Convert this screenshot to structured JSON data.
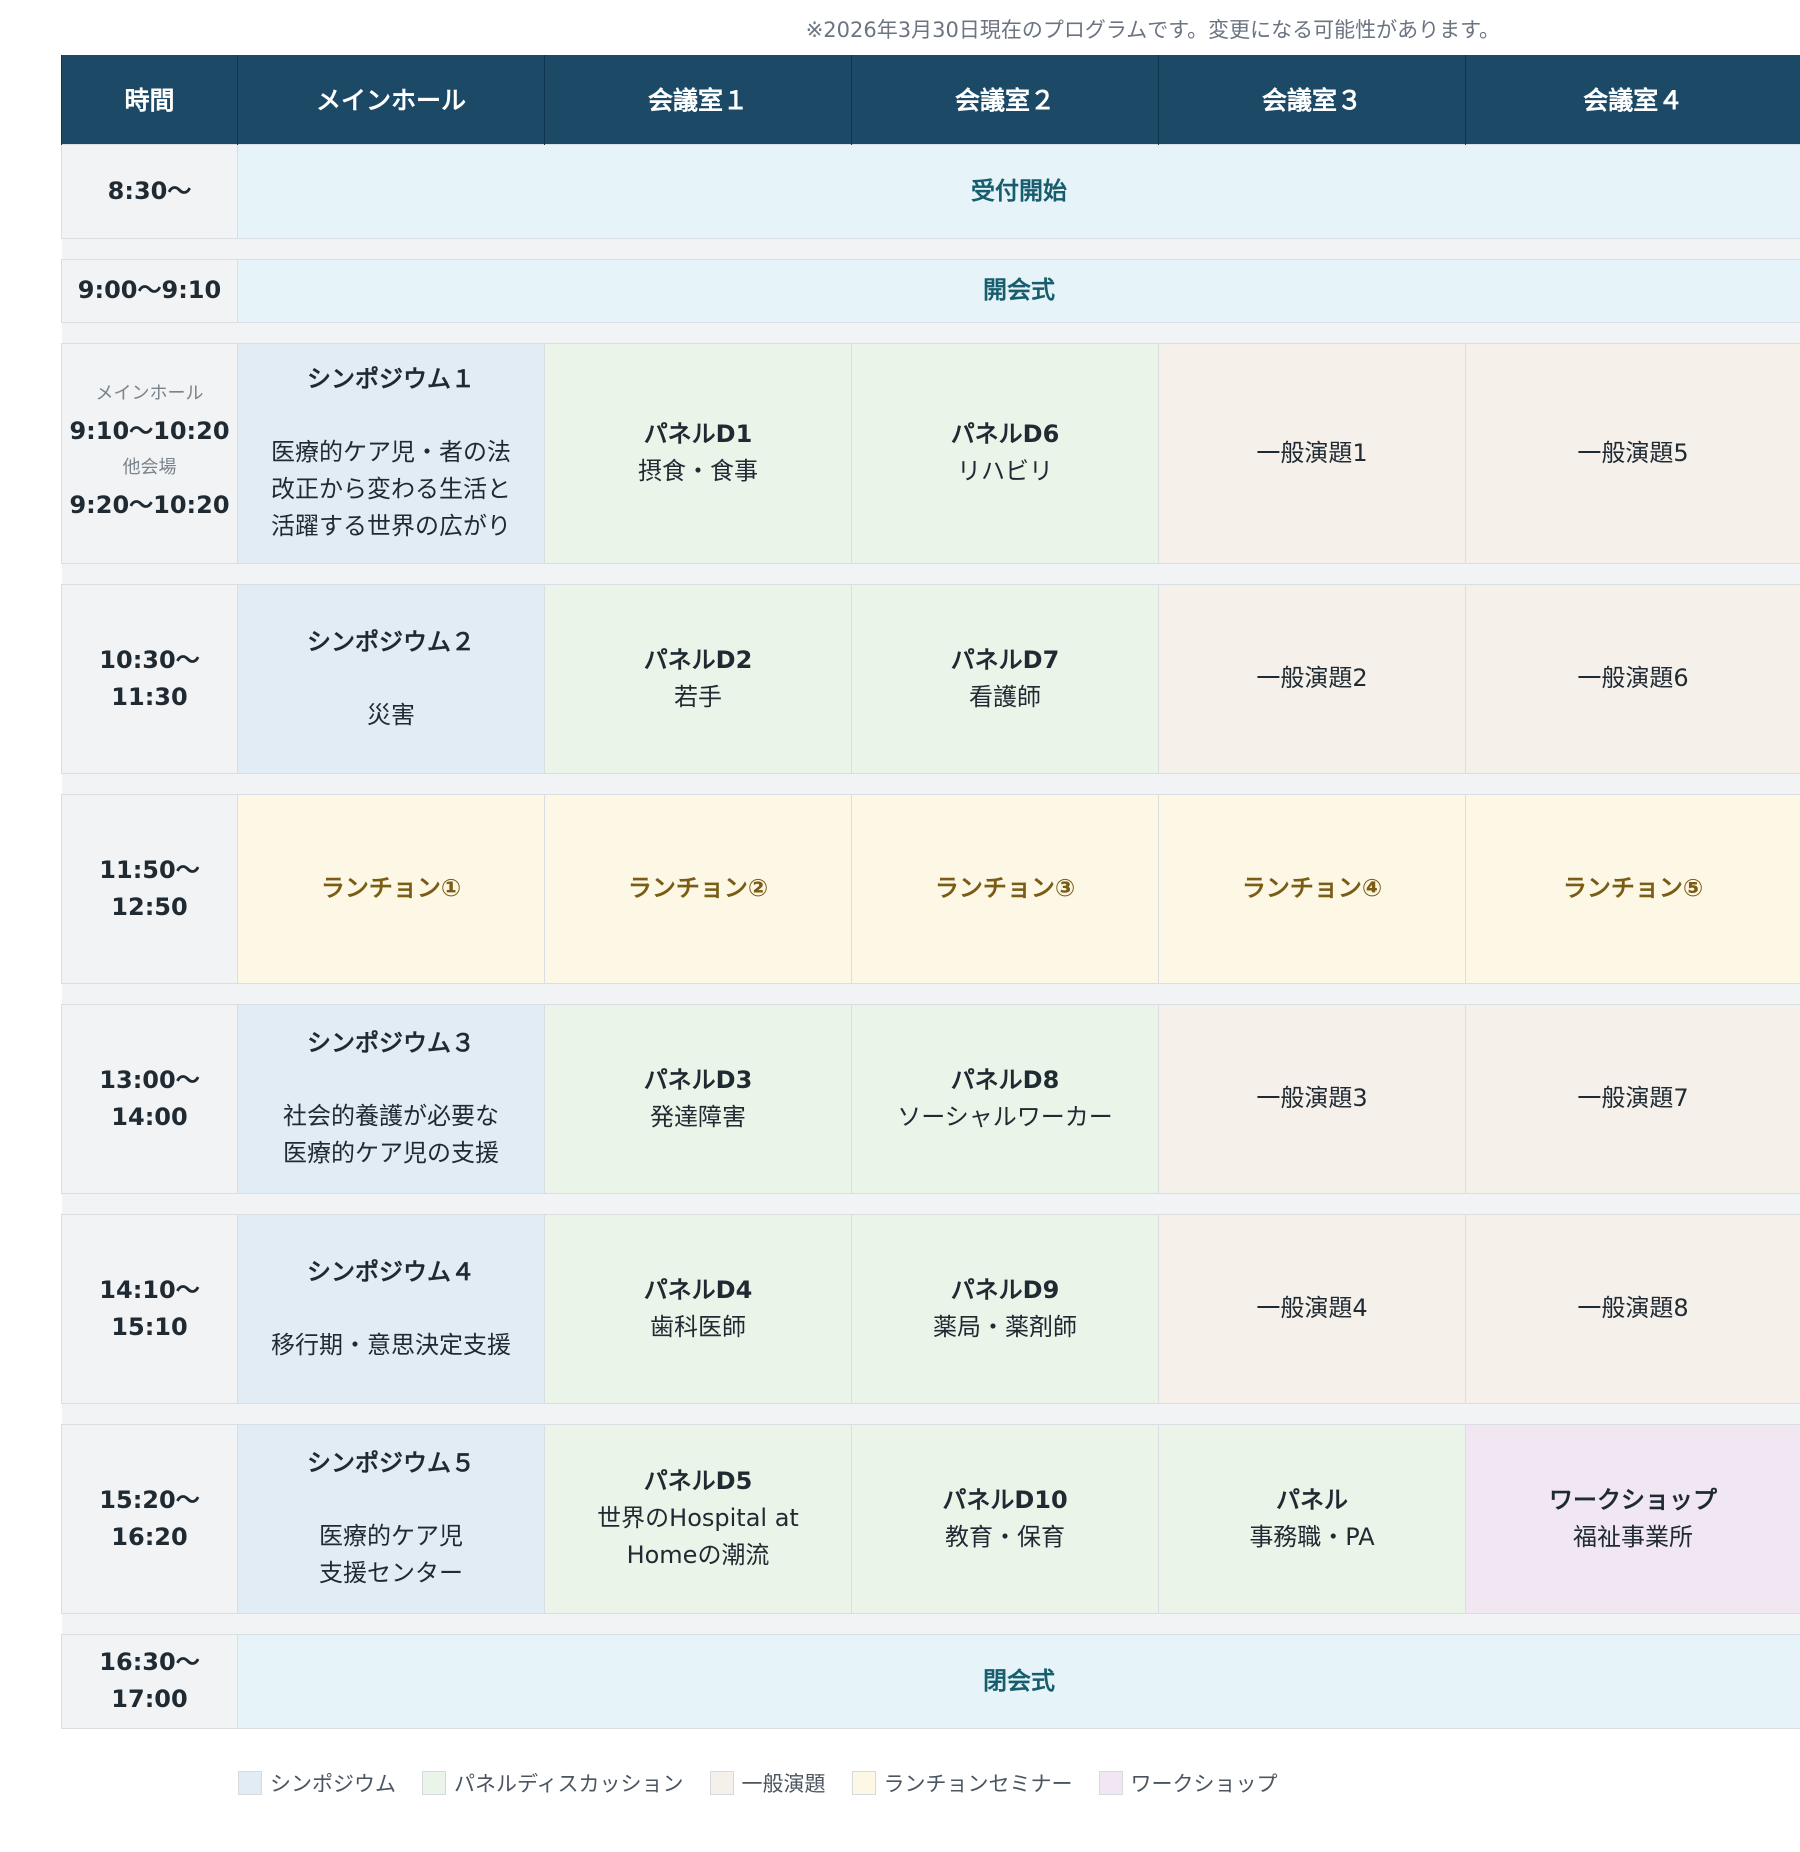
{
  "note": "※2026年3月30日現在のプログラムです。変更になる可能性があります。",
  "headers": [
    "時間",
    "メインホール",
    "会議室１",
    "会議室２",
    "会議室３",
    "会議室４"
  ],
  "rows": {
    "reception": {
      "time": "8:30〜",
      "label": "受付開始"
    },
    "opening": {
      "time": "9:00〜9:10",
      "label": "開会式"
    },
    "s1": {
      "time_main_label": "メインホール",
      "time_main": "9:10〜10:20",
      "time_other_label": "他会場",
      "time_other": "9:20〜10:20",
      "sympo_title": "シンポジウム１",
      "sympo_lines": [
        "医療的ケア児・者の法",
        "改正から変わる生活と",
        "活躍する世界の広がり"
      ],
      "r1_title": "パネルD1",
      "r1_sub": "摂食・食事",
      "r2_title": "パネルD6",
      "r2_sub": "リハビリ",
      "r3": "一般演題1",
      "r4": "一般演題5"
    },
    "s2": {
      "time": "10:30〜11:30",
      "sympo_title": "シンポジウム２",
      "sympo_lines": [
        "災害"
      ],
      "r1_title": "パネルD2",
      "r1_sub": "若手",
      "r2_title": "パネルD7",
      "r2_sub": "看護師",
      "r3": "一般演題2",
      "r4": "一般演題6"
    },
    "lunch": {
      "time": "11:50〜12:50",
      "items": [
        "ランチョン①",
        "ランチョン②",
        "ランチョン③",
        "ランチョン④",
        "ランチョン⑤"
      ]
    },
    "s3": {
      "time": "13:00〜14:00",
      "sympo_title": "シンポジウム３",
      "sympo_lines": [
        "社会的養護が必要な",
        "医療的ケア児の支援"
      ],
      "r1_title": "パネルD3",
      "r1_sub": "発達障害",
      "r2_title": "パネルD8",
      "r2_sub": "ソーシャルワーカー",
      "r3": "一般演題3",
      "r4": "一般演題7"
    },
    "s4": {
      "time": "14:10〜15:10",
      "sympo_title": "シンポジウム４",
      "sympo_lines": [
        "移行期・意思決定支援"
      ],
      "r1_title": "パネルD4",
      "r1_sub": "歯科医師",
      "r2_title": "パネルD9",
      "r2_sub": "薬局・薬剤師",
      "r3": "一般演題4",
      "r4": "一般演題8"
    },
    "s5": {
      "time": "15:20〜16:20",
      "sympo_title": "シンポジウム５",
      "sympo_lines": [
        "医療的ケア児",
        "支援センター"
      ],
      "r1_title": "パネルD5",
      "r1_sub_lines": [
        "世界のHospital at",
        "Homeの潮流"
      ],
      "r2_title": "パネルD10",
      "r2_sub": "教育・保育",
      "r3_title": "パネル",
      "r3_sub": "事務職・PA",
      "r4_title": "ワークショップ",
      "r4_sub": "福祉事業所"
    },
    "closing": {
      "time": "16:30〜17:00",
      "label": "閉会式"
    }
  },
  "legend": [
    {
      "label": "シンポジウム",
      "color": "#e2ecf5"
    },
    {
      "label": "パネルディスカッション",
      "color": "#ebf4e8"
    },
    {
      "label": "一般演題",
      "color": "#f5f0e9"
    },
    {
      "label": "ランチョンセミナー",
      "color": "#fdf7e5"
    },
    {
      "label": "ワークショップ",
      "color": "#f1e7f3"
    }
  ]
}
